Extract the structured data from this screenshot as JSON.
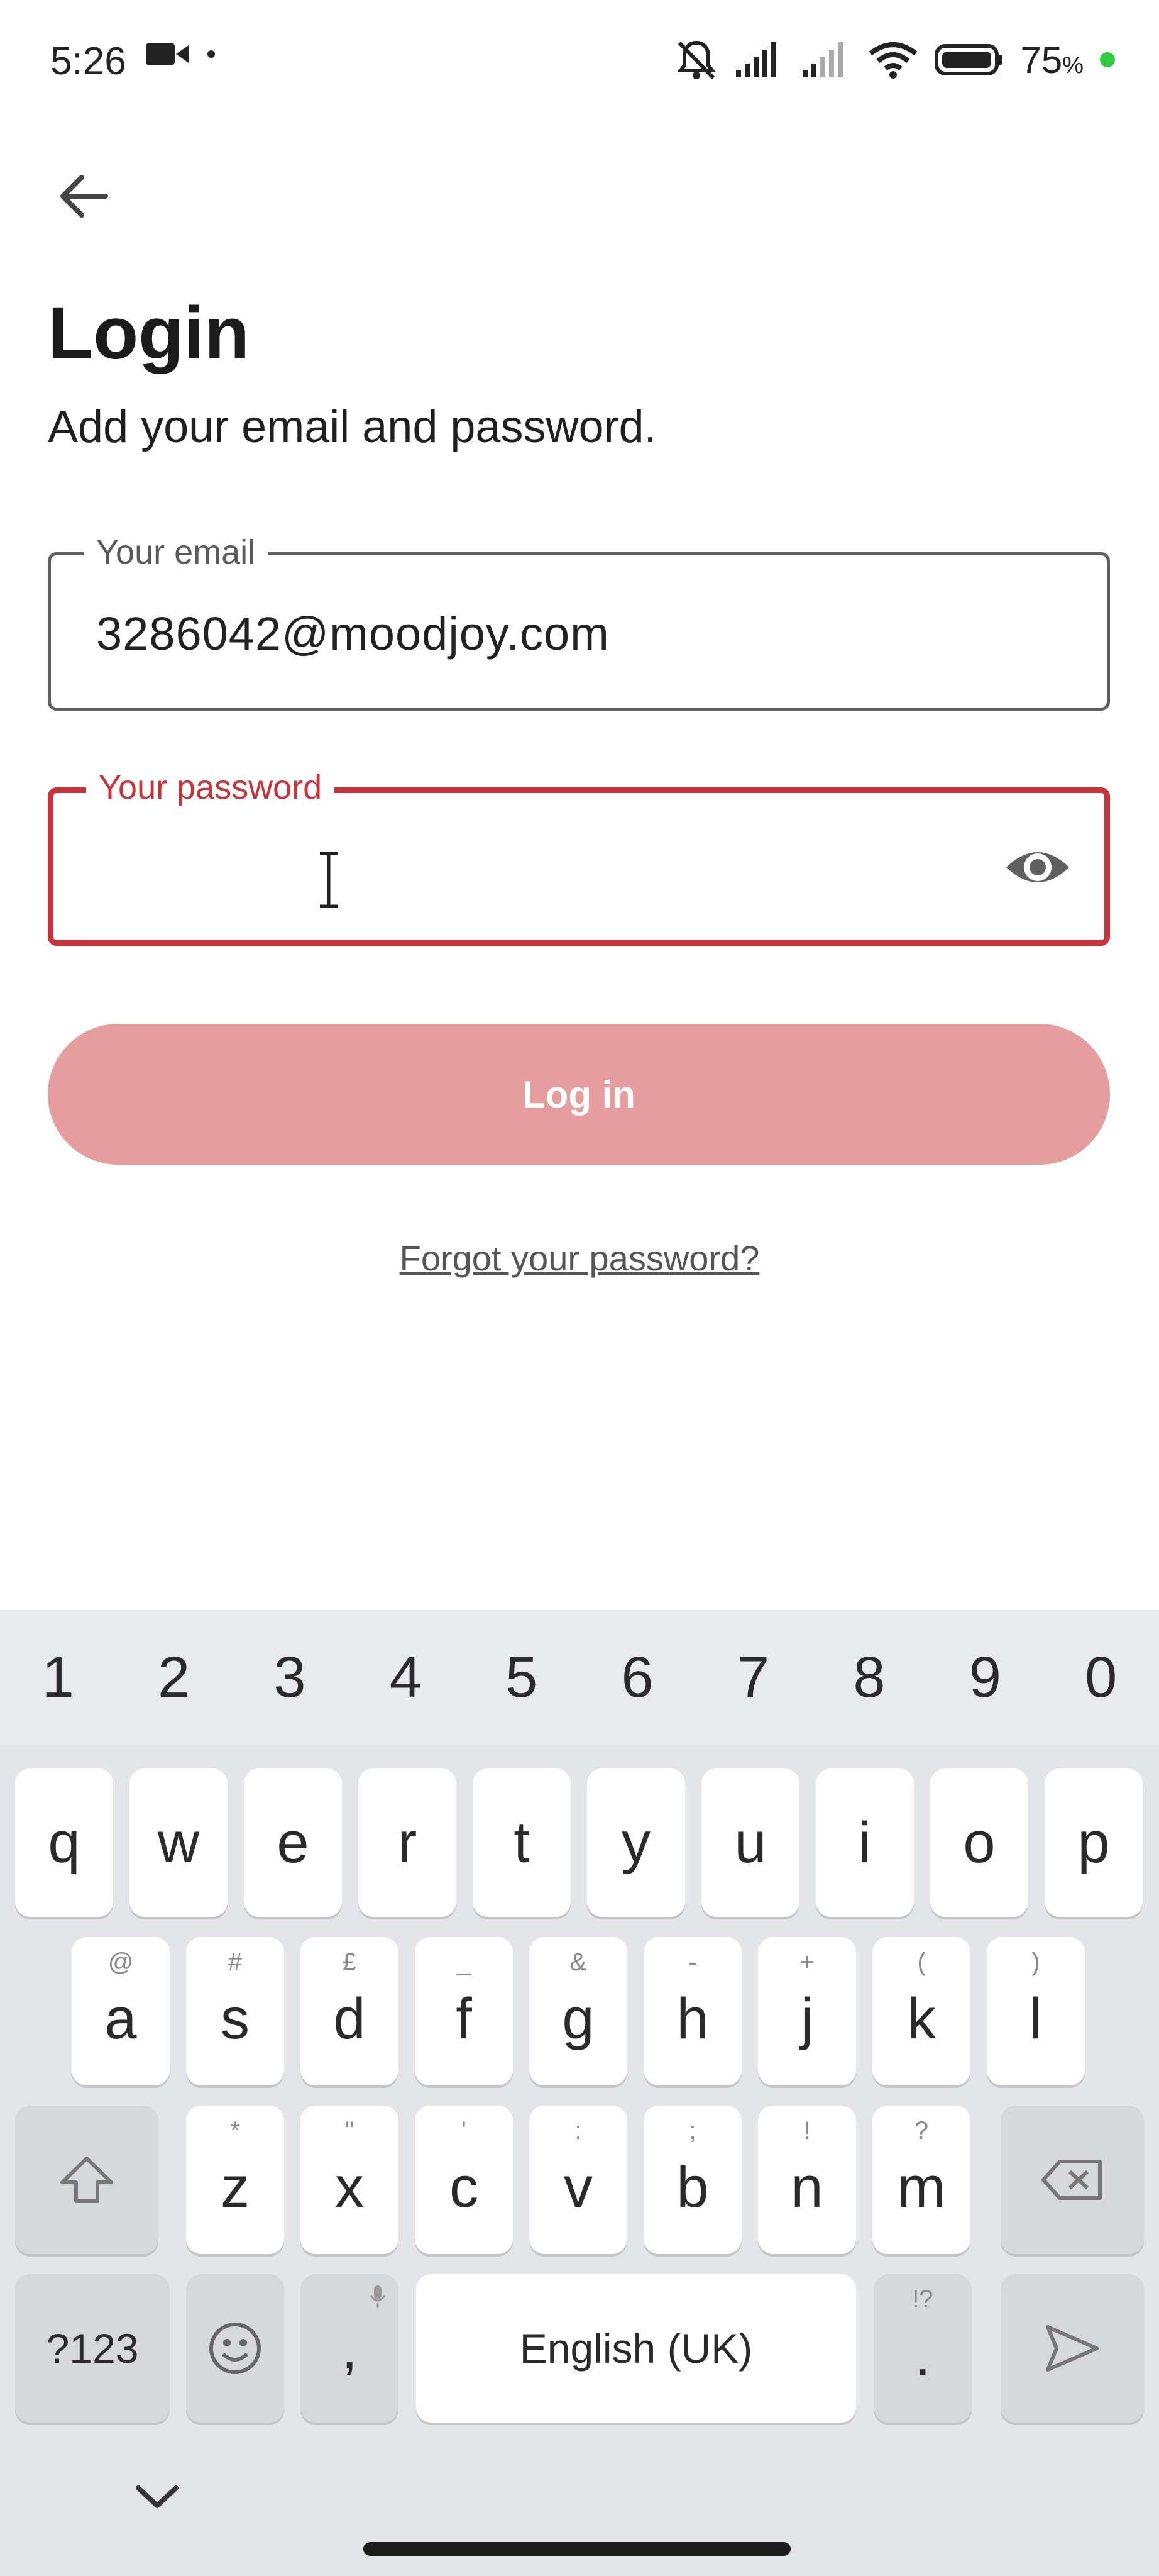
{
  "status_bar": {
    "time": "5:26",
    "battery_percent": "75",
    "battery_symbol": "%"
  },
  "page": {
    "title": "Login",
    "subtitle": "Add your email and password."
  },
  "form": {
    "email_label": "Your email",
    "email_value": "3286042@moodjoy.com",
    "password_label": "Your password",
    "password_value": ""
  },
  "actions": {
    "login_label": "Log in",
    "forgot_label": "Forgot your password?"
  },
  "colors": {
    "accent": "#c8333c",
    "button_disabled": "#e59e9d"
  },
  "keyboard": {
    "numbers": [
      "1",
      "2",
      "3",
      "4",
      "5",
      "6",
      "7",
      "8",
      "9",
      "0"
    ],
    "row1": [
      "q",
      "w",
      "e",
      "r",
      "t",
      "y",
      "u",
      "i",
      "o",
      "p"
    ],
    "row2": [
      {
        "key": "a",
        "hint": "@"
      },
      {
        "key": "s",
        "hint": "#"
      },
      {
        "key": "d",
        "hint": "£"
      },
      {
        "key": "f",
        "hint": "_"
      },
      {
        "key": "g",
        "hint": "&"
      },
      {
        "key": "h",
        "hint": "-"
      },
      {
        "key": "j",
        "hint": "+"
      },
      {
        "key": "k",
        "hint": "("
      },
      {
        "key": "l",
        "hint": ")"
      }
    ],
    "row3": [
      {
        "key": "z",
        "hint": "*"
      },
      {
        "key": "x",
        "hint": "\""
      },
      {
        "key": "c",
        "hint": "'"
      },
      {
        "key": "v",
        "hint": ":"
      },
      {
        "key": "b",
        "hint": ";"
      },
      {
        "key": "n",
        "hint": "!"
      },
      {
        "key": "m",
        "hint": "?"
      }
    ],
    "symbols_label": "?123",
    "comma": ",",
    "space_label": "English (UK)",
    "period": ".",
    "period_hint": "!?"
  }
}
